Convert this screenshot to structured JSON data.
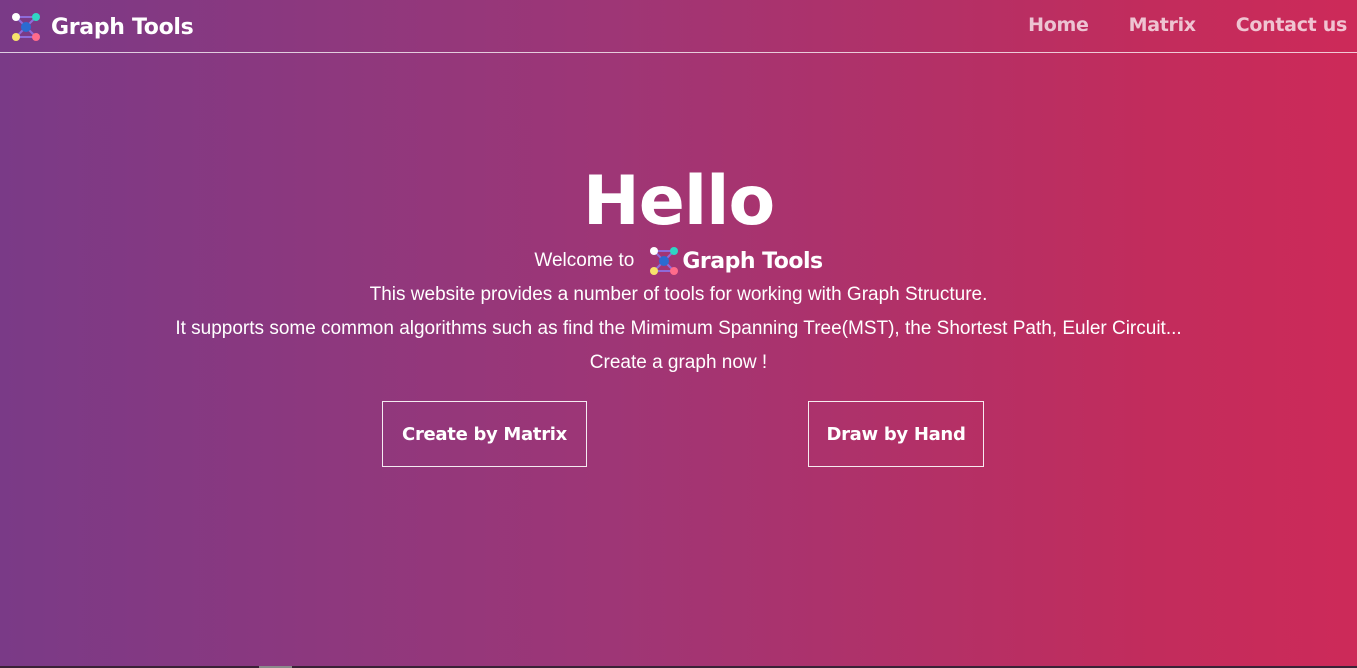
{
  "navbar": {
    "brand": "Graph Tools",
    "brand_icon": "graph-nodes-icon",
    "links": [
      "Home",
      "Matrix",
      "Contact us"
    ]
  },
  "hero": {
    "title": "Hello",
    "welcome": "Welcome to",
    "welcome_brand": "Graph Tools",
    "lines": [
      "This website provides a number of tools for working with Graph Structure.",
      "It supports some common algorithms such as find the Mimimum Spanning Tree(MST), the Shortest Path, Euler Circuit...",
      "Create a graph now !"
    ]
  },
  "buttons": {
    "matrix": "Create by Matrix",
    "hand": "Draw by Hand"
  },
  "colors": {
    "gradient_start": "#7a3a87",
    "gradient_end": "#cd2a59",
    "node_yellow": "#f7e36b",
    "node_teal": "#2fd5c4",
    "node_pink": "#ff6b8b",
    "node_blue": "#2b6bd1"
  }
}
